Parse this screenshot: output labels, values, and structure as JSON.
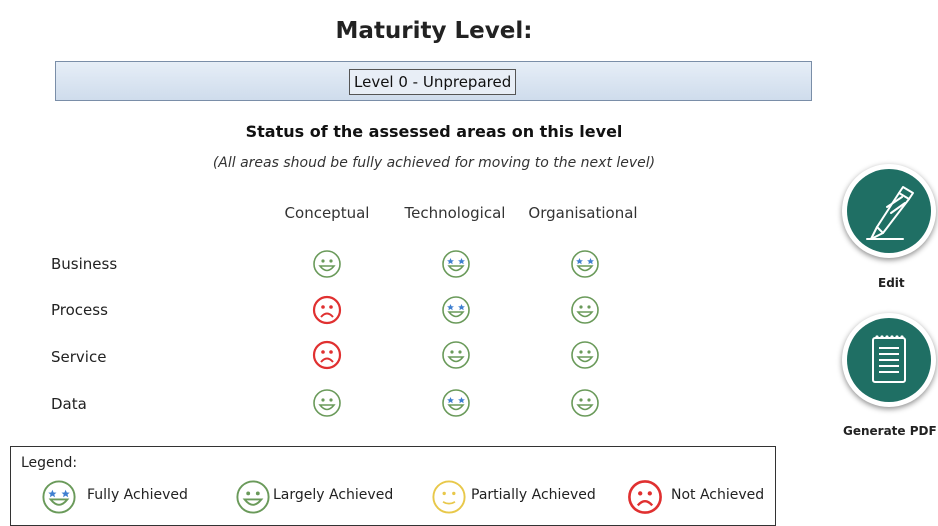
{
  "header": {
    "title": "Maturity Level:",
    "level_value": "Level 0 - Unprepared"
  },
  "status": {
    "title": "Status of the assessed areas on this level",
    "note": "(All areas shoud be fully achieved for moving to the next level)"
  },
  "columns": [
    "Conceptual",
    "Technological",
    "Organisational"
  ],
  "rows": [
    {
      "label": "Business",
      "statuses": [
        "largely",
        "fully",
        "fully"
      ]
    },
    {
      "label": "Process",
      "statuses": [
        "not",
        "fully",
        "largely"
      ]
    },
    {
      "label": "Service",
      "statuses": [
        "not",
        "largely",
        "largely"
      ]
    },
    {
      "label": "Data",
      "statuses": [
        "largely",
        "fully",
        "largely"
      ]
    }
  ],
  "colors": {
    "fully": "#6a9a5a",
    "largely": "#6a9a5a",
    "partially": "#e8c84a",
    "not": "#e03030",
    "star": "#3f7fd0",
    "button_fill": "#1f6f64"
  },
  "actions": {
    "edit_label": "Edit",
    "edit_icon": "pen-icon",
    "pdf_label": "Generate PDF",
    "pdf_icon": "notepad-icon"
  },
  "legend": {
    "title": "Legend:",
    "items": [
      {
        "key": "fully",
        "label": "Fully Achieved"
      },
      {
        "key": "largely",
        "label": "Largely Achieved"
      },
      {
        "key": "partially",
        "label": "Partially Achieved"
      },
      {
        "key": "not",
        "label": "Not Achieved"
      }
    ]
  }
}
